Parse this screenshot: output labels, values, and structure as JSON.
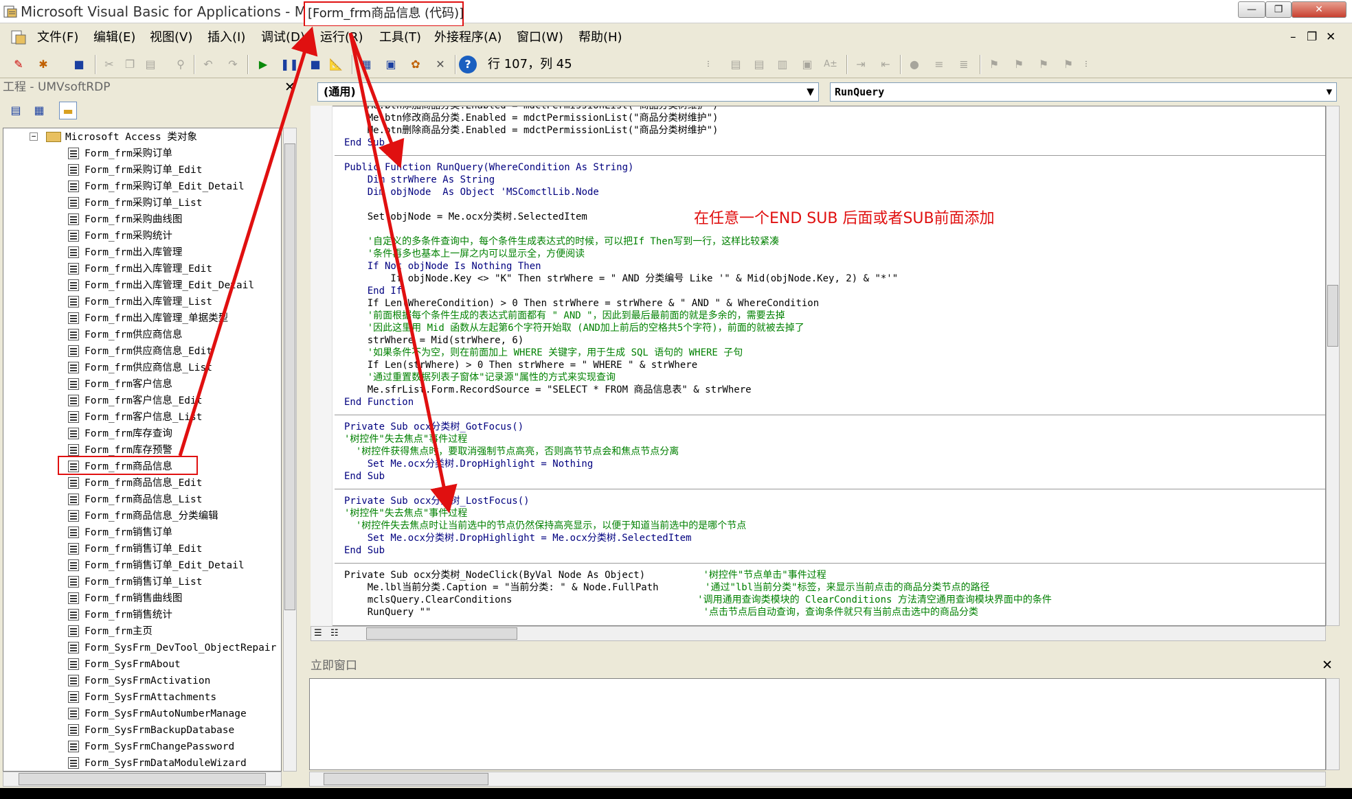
{
  "window": {
    "title": "Microsoft Visual Basic for Applications - Main - ",
    "title_highlight": "[Form_frm商品信息 (代码)]",
    "controls": {
      "minimize": "—",
      "restore": "❐",
      "close": "✕"
    }
  },
  "menu": {
    "items": [
      "文件(F)",
      "编辑(E)",
      "视图(V)",
      "插入(I)",
      "调试(D)",
      "运行(R)",
      "工具(T)",
      "外接程序(A)",
      "窗口(W)",
      "帮助(H)"
    ],
    "mdi": {
      "minimize": "–",
      "restore": "❐",
      "close": "✕"
    }
  },
  "toolbar": {
    "position": "行 107，列 45"
  },
  "project": {
    "title": "工程 - UMVsoftRDP",
    "close": "✕",
    "folder": "Microsoft Access 类对象",
    "items": [
      "Form_frm采购订单",
      "Form_frm采购订单_Edit",
      "Form_frm采购订单_Edit_Detail",
      "Form_frm采购订单_List",
      "Form_frm采购曲线图",
      "Form_frm采购统计",
      "Form_frm出入库管理",
      "Form_frm出入库管理_Edit",
      "Form_frm出入库管理_Edit_Detail",
      "Form_frm出入库管理_List",
      "Form_frm出入库管理_单据类型",
      "Form_frm供应商信息",
      "Form_frm供应商信息_Edit",
      "Form_frm供应商信息_List",
      "Form_frm客户信息",
      "Form_frm客户信息_Edit",
      "Form_frm客户信息_List",
      "Form_frm库存查询",
      "Form_frm库存预警",
      "Form_frm商品信息",
      "Form_frm商品信息_Edit",
      "Form_frm商品信息_List",
      "Form_frm商品信息_分类编辑",
      "Form_frm销售订单",
      "Form_frm销售订单_Edit",
      "Form_frm销售订单_Edit_Detail",
      "Form_frm销售订单_List",
      "Form_frm销售曲线图",
      "Form_frm销售统计",
      "Form_frm主页",
      "Form_SysFrm_DevTool_ObjectRepair",
      "Form_SysFrmAbout",
      "Form_SysFrmActivation",
      "Form_SysFrmAttachments",
      "Form_SysFrmAutoNumberManage",
      "Form_SysFrmBackupDatabase",
      "Form_SysFrmChangePassword",
      "Form_SysFrmDataModuleWizard"
    ],
    "selected": "Form_frm商品信息"
  },
  "code": {
    "object_combo": "(通用)",
    "proc_combo": "RunQuery",
    "annotation": "在任意一个END SUB 后面或者SUB前面添加",
    "lines": [
      {
        "t": "    Me.btn添加商品分类.Enabled = mdctPermissionList(\"商品分类树维护\")",
        "c": ""
      },
      {
        "t": "    Me.btn修改商品分类.Enabled = mdctPermissionList(\"商品分类树维护\")",
        "c": ""
      },
      {
        "t": "    Me.btn删除商品分类.Enabled = mdctPermissionList(\"商品分类树维护\")",
        "c": ""
      },
      {
        "t": "End Sub",
        "c": "kw"
      },
      {
        "t": "",
        "c": "sep"
      },
      {
        "t": "Public Function RunQuery(WhereCondition As String)",
        "c": "kw"
      },
      {
        "t": "    Dim strWhere As String",
        "c": "kw"
      },
      {
        "t": "    Dim objNode  As Object 'MSComctlLib.Node",
        "c": "kw"
      },
      {
        "t": "",
        "c": ""
      },
      {
        "t": "    Set objNode = Me.ocx分类树.SelectedItem",
        "c": ""
      },
      {
        "t": "",
        "c": ""
      },
      {
        "t": "    '自定义的多条件查询中，每个条件生成表达式的时候，可以把If Then写到一行，这样比较紧凑",
        "c": "cm"
      },
      {
        "t": "    '条件再多也基本上一屏之内可以显示全，方便阅读",
        "c": "cm"
      },
      {
        "t": "    If Not objNode Is Nothing Then",
        "c": "kw"
      },
      {
        "t": "        If objNode.Key <> \"K\" Then strWhere = \" AND 分类编号 Like '\" & Mid(objNode.Key, 2) & \"*'\"",
        "c": ""
      },
      {
        "t": "    End If",
        "c": "kw"
      },
      {
        "t": "    If Len(WhereCondition) > 0 Then strWhere = strWhere & \" AND \" & WhereCondition",
        "c": ""
      },
      {
        "t": "    '前面根据每个条件生成的表达式前面都有 \" AND \"，因此到最后最前面的就是多余的，需要去掉",
        "c": "cm"
      },
      {
        "t": "    '因此这里用 Mid 函数从左起第6个字符开始取 (AND加上前后的空格共5个字符)，前面的就被去掉了",
        "c": "cm"
      },
      {
        "t": "    strWhere = Mid(strWhere, 6)",
        "c": ""
      },
      {
        "t": "    '如果条件不为空，则在前面加上 WHERE 关键字，用于生成 SQL 语句的 WHERE 子句",
        "c": "cm"
      },
      {
        "t": "    If Len(strWhere) > 0 Then strWhere = \" WHERE \" & strWhere",
        "c": ""
      },
      {
        "t": "    '通过重置数据列表子窗体\"记录源\"属性的方式来实现查询",
        "c": "cm"
      },
      {
        "t": "    Me.sfrList.Form.RecordSource = \"SELECT * FROM 商品信息表\" & strWhere",
        "c": ""
      },
      {
        "t": "End Function",
        "c": "kw"
      },
      {
        "t": "",
        "c": "sep"
      },
      {
        "t": "Private Sub ocx分类树_GotFocus()",
        "c": "kw"
      },
      {
        "t": "'树控件\"失去焦点\"事件过程",
        "c": "cm"
      },
      {
        "t": "  '树控件获得焦点时，要取消强制节点高亮，否则高节节点会和焦点节点分离",
        "c": "cm"
      },
      {
        "t": "    Set Me.ocx分类树.DropHighlight = Nothing",
        "c": "kw"
      },
      {
        "t": "End Sub",
        "c": "kw"
      },
      {
        "t": "",
        "c": "sep"
      },
      {
        "t": "Private Sub ocx分类树_LostFocus()",
        "c": "kw"
      },
      {
        "t": "'树控件\"失去焦点\"事件过程",
        "c": "cm"
      },
      {
        "t": "  '树控件失去焦点时让当前选中的节点仍然保持高亮显示，以便于知道当前选中的是哪个节点",
        "c": "cm"
      },
      {
        "t": "    Set Me.ocx分类树.DropHighlight = Me.ocx分类树.SelectedItem",
        "c": "kw"
      },
      {
        "t": "End Sub",
        "c": "kw"
      },
      {
        "t": "",
        "c": "sep"
      },
      {
        "t": "Private Sub ocx分类树_NodeClick(ByVal Node As Object)          '树控件\"节点单击\"事件过程",
        "c": "mix"
      },
      {
        "t": "    Me.lbl当前分类.Caption = \"当前分类: \" & Node.FullPath        '通过\"lbl当前分类\"标签，来显示当前点击的商品分类节点的路径",
        "c": "mix"
      },
      {
        "t": "    mclsQuery.ClearConditions                                '调用通用查询类模块的 ClearConditions 方法清空通用查询模块界面中的条件",
        "c": "mix"
      },
      {
        "t": "    RunQuery \"\"                                               '点击节点后自动查询，查询条件就只有当前点击选中的商品分类",
        "c": "mix"
      }
    ]
  },
  "immediate": {
    "title": "立即窗口",
    "close": "✕"
  },
  "colors": {
    "highlight": "#e01010",
    "keyword": "#00007f",
    "comment": "#008000"
  }
}
